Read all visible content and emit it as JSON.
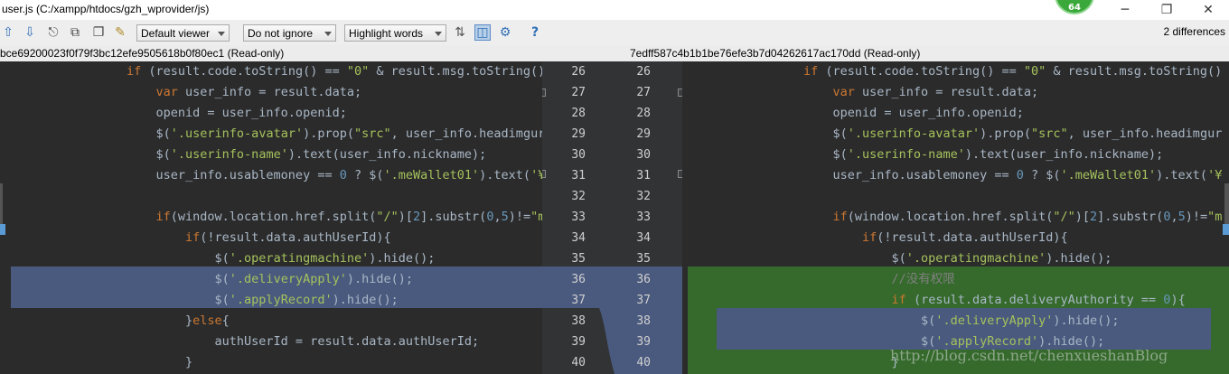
{
  "window": {
    "title": "user.js (C:/xampp/htdocs/gzh_wprovider/js)",
    "badge": "64",
    "minimize": "─",
    "maximize": "❐",
    "close": "✕"
  },
  "toolbar": {
    "viewer": "Default viewer",
    "ignore": "Do not ignore",
    "highlight": "Highlight words",
    "help": "?",
    "differences": "2 differences"
  },
  "left_header": "bce69200023f0f79f3bc12efe9505618b0f80ec1 (Read-only)",
  "right_header": "7edff587c4b1b1be76efe3b7d04262617ac170dd (Read-only)",
  "left_numbers": [
    "26",
    "27",
    "28",
    "29",
    "30",
    "31",
    "32",
    "33",
    "34",
    "35",
    "36",
    "37",
    "38",
    "39",
    "40"
  ],
  "right_numbers": [
    "26",
    "27",
    "28",
    "29",
    "30",
    "31",
    "32",
    "33",
    "34",
    "35",
    "36",
    "37",
    "38",
    "39",
    "40"
  ],
  "left_code": [
    "if (result.code.toString() == \"0\" & result.msg.toString()",
    "    var user_info = result.data;",
    "    openid = user_info.openid;",
    "    $('.userinfo-avatar').prop(\"src\", user_info.headimgur",
    "    $('.userinfo-name').text(user_info.nickname);",
    "    user_info.usablemoney == 0 ? $('.meWallet01').text('¥",
    "",
    "    if(window.location.href.split(\"/\")[2].substr(0,5)!=\"m",
    "        if(!result.data.authUserId){",
    "            $('.operatingmachine').hide();",
    "            $('.deliveryApply').hide();",
    "            $('.applyRecord').hide();",
    "        }else{",
    "            authUserId = result.data.authUserId;",
    "        }"
  ],
  "right_code": [
    "if (result.code.toString() == \"0\" & result.msg.toString()",
    "    var user_info = result.data;",
    "    openid = user_info.openid;",
    "    $('.userinfo-avatar').prop(\"src\", user_info.headimgur",
    "    $('.userinfo-name').text(user_info.nickname);",
    "    user_info.usablemoney == 0 ? $('.meWallet01').text('¥",
    "",
    "    if(window.location.href.split(\"/\")[2].substr(0,5)!=\"m",
    "        if(!result.data.authUserId){",
    "            $('.operatingmachine').hide();",
    "            //没有权限",
    "            if (result.data.deliveryAuthority == 0){",
    "                $('.deliveryApply').hide();",
    "                $('.applyRecord').hide();",
    "            }"
  ],
  "watermark": "http://blog.csdn.net/chenxueshanBlog",
  "colors": {
    "editor_bg": "#2b2b2b",
    "changed_blue": "#4a5a7e",
    "inserted_green": "#356a2c",
    "keyword": "#cc7832",
    "string": "#a5c25c"
  }
}
